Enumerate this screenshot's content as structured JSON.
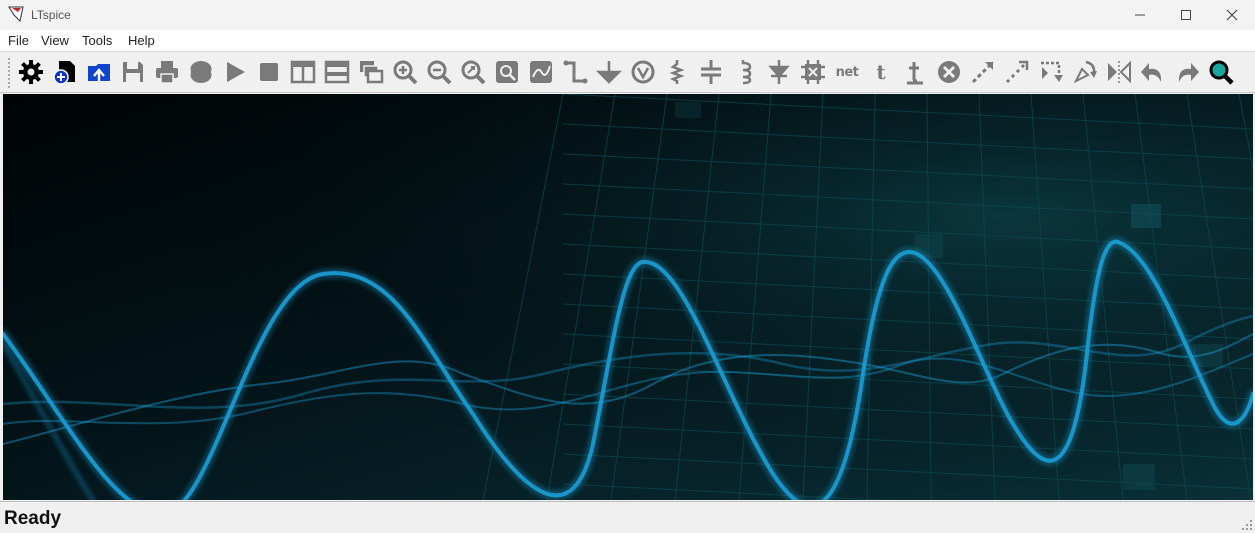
{
  "window": {
    "title": "LTspice",
    "accent": "#c0272d"
  },
  "menu": [
    {
      "label": "File"
    },
    {
      "label": "View"
    },
    {
      "label": "Tools"
    },
    {
      "label": "Help"
    }
  ],
  "toolbar_icons": [
    "settings-gear-icon",
    "new-schematic-icon",
    "open-file-icon",
    "save-icon",
    "print-icon",
    "component-blob-icon",
    "run-icon",
    "halt-icon",
    "tile-vertical-icon",
    "tile-horizontal-icon",
    "cascade-windows-icon",
    "zoom-in-icon",
    "zoom-out-icon",
    "zoom-fit-icon",
    "zoom-full-icon",
    "autoscale-icon",
    "draw-wire-icon",
    "ground-icon",
    "voltage-source-icon",
    "resistor-icon",
    "capacitor-icon",
    "inductor-icon",
    "diode-icon",
    "component-icon",
    "net-label-icon",
    "text-icon",
    "spice-directive-icon",
    "delete-icon",
    "move-icon",
    "drag-icon",
    "rotate-icon",
    "rotate-alt-icon",
    "mirror-icon",
    "undo-icon",
    "redo-icon",
    "find-icon"
  ],
  "toolbar": {
    "net_label": "net",
    "text_label": "t"
  },
  "status": {
    "text": "Ready"
  },
  "colors": {
    "wave": "#1a9fd6",
    "grid": "#0d4a52",
    "icon_gray": "#7a7a7a"
  }
}
